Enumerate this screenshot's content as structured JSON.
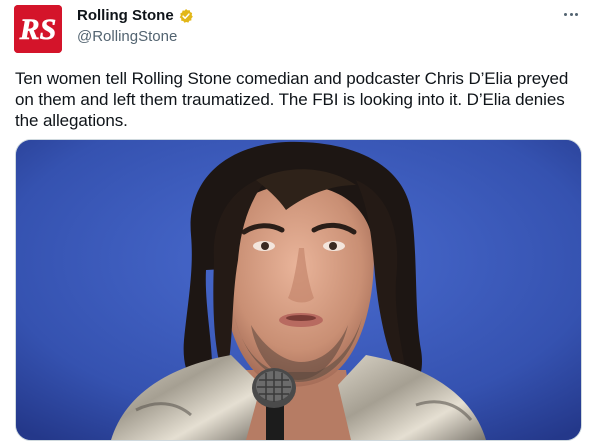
{
  "tweet": {
    "author": {
      "name": "Rolling Stone",
      "handle": "@RollingStone",
      "logo_text": "RS",
      "verified": true
    },
    "text": "Ten women tell Rolling Stone comedian and podcaster Chris D’Elia preyed on them and left them traumatized. The FBI is looking into it. D’Elia denies the allegations.",
    "media": {
      "type": "photo",
      "subject": "man with shoulder-length dark hair and beard speaking into a microphone on stage"
    },
    "more_icon": "more-horizontal-icon"
  },
  "colors": {
    "brand_red": "#d4142a",
    "verified_gold": "#e2b719",
    "text_primary": "#0f1419",
    "text_secondary": "#536471",
    "photo_background": "#3a57b8"
  }
}
